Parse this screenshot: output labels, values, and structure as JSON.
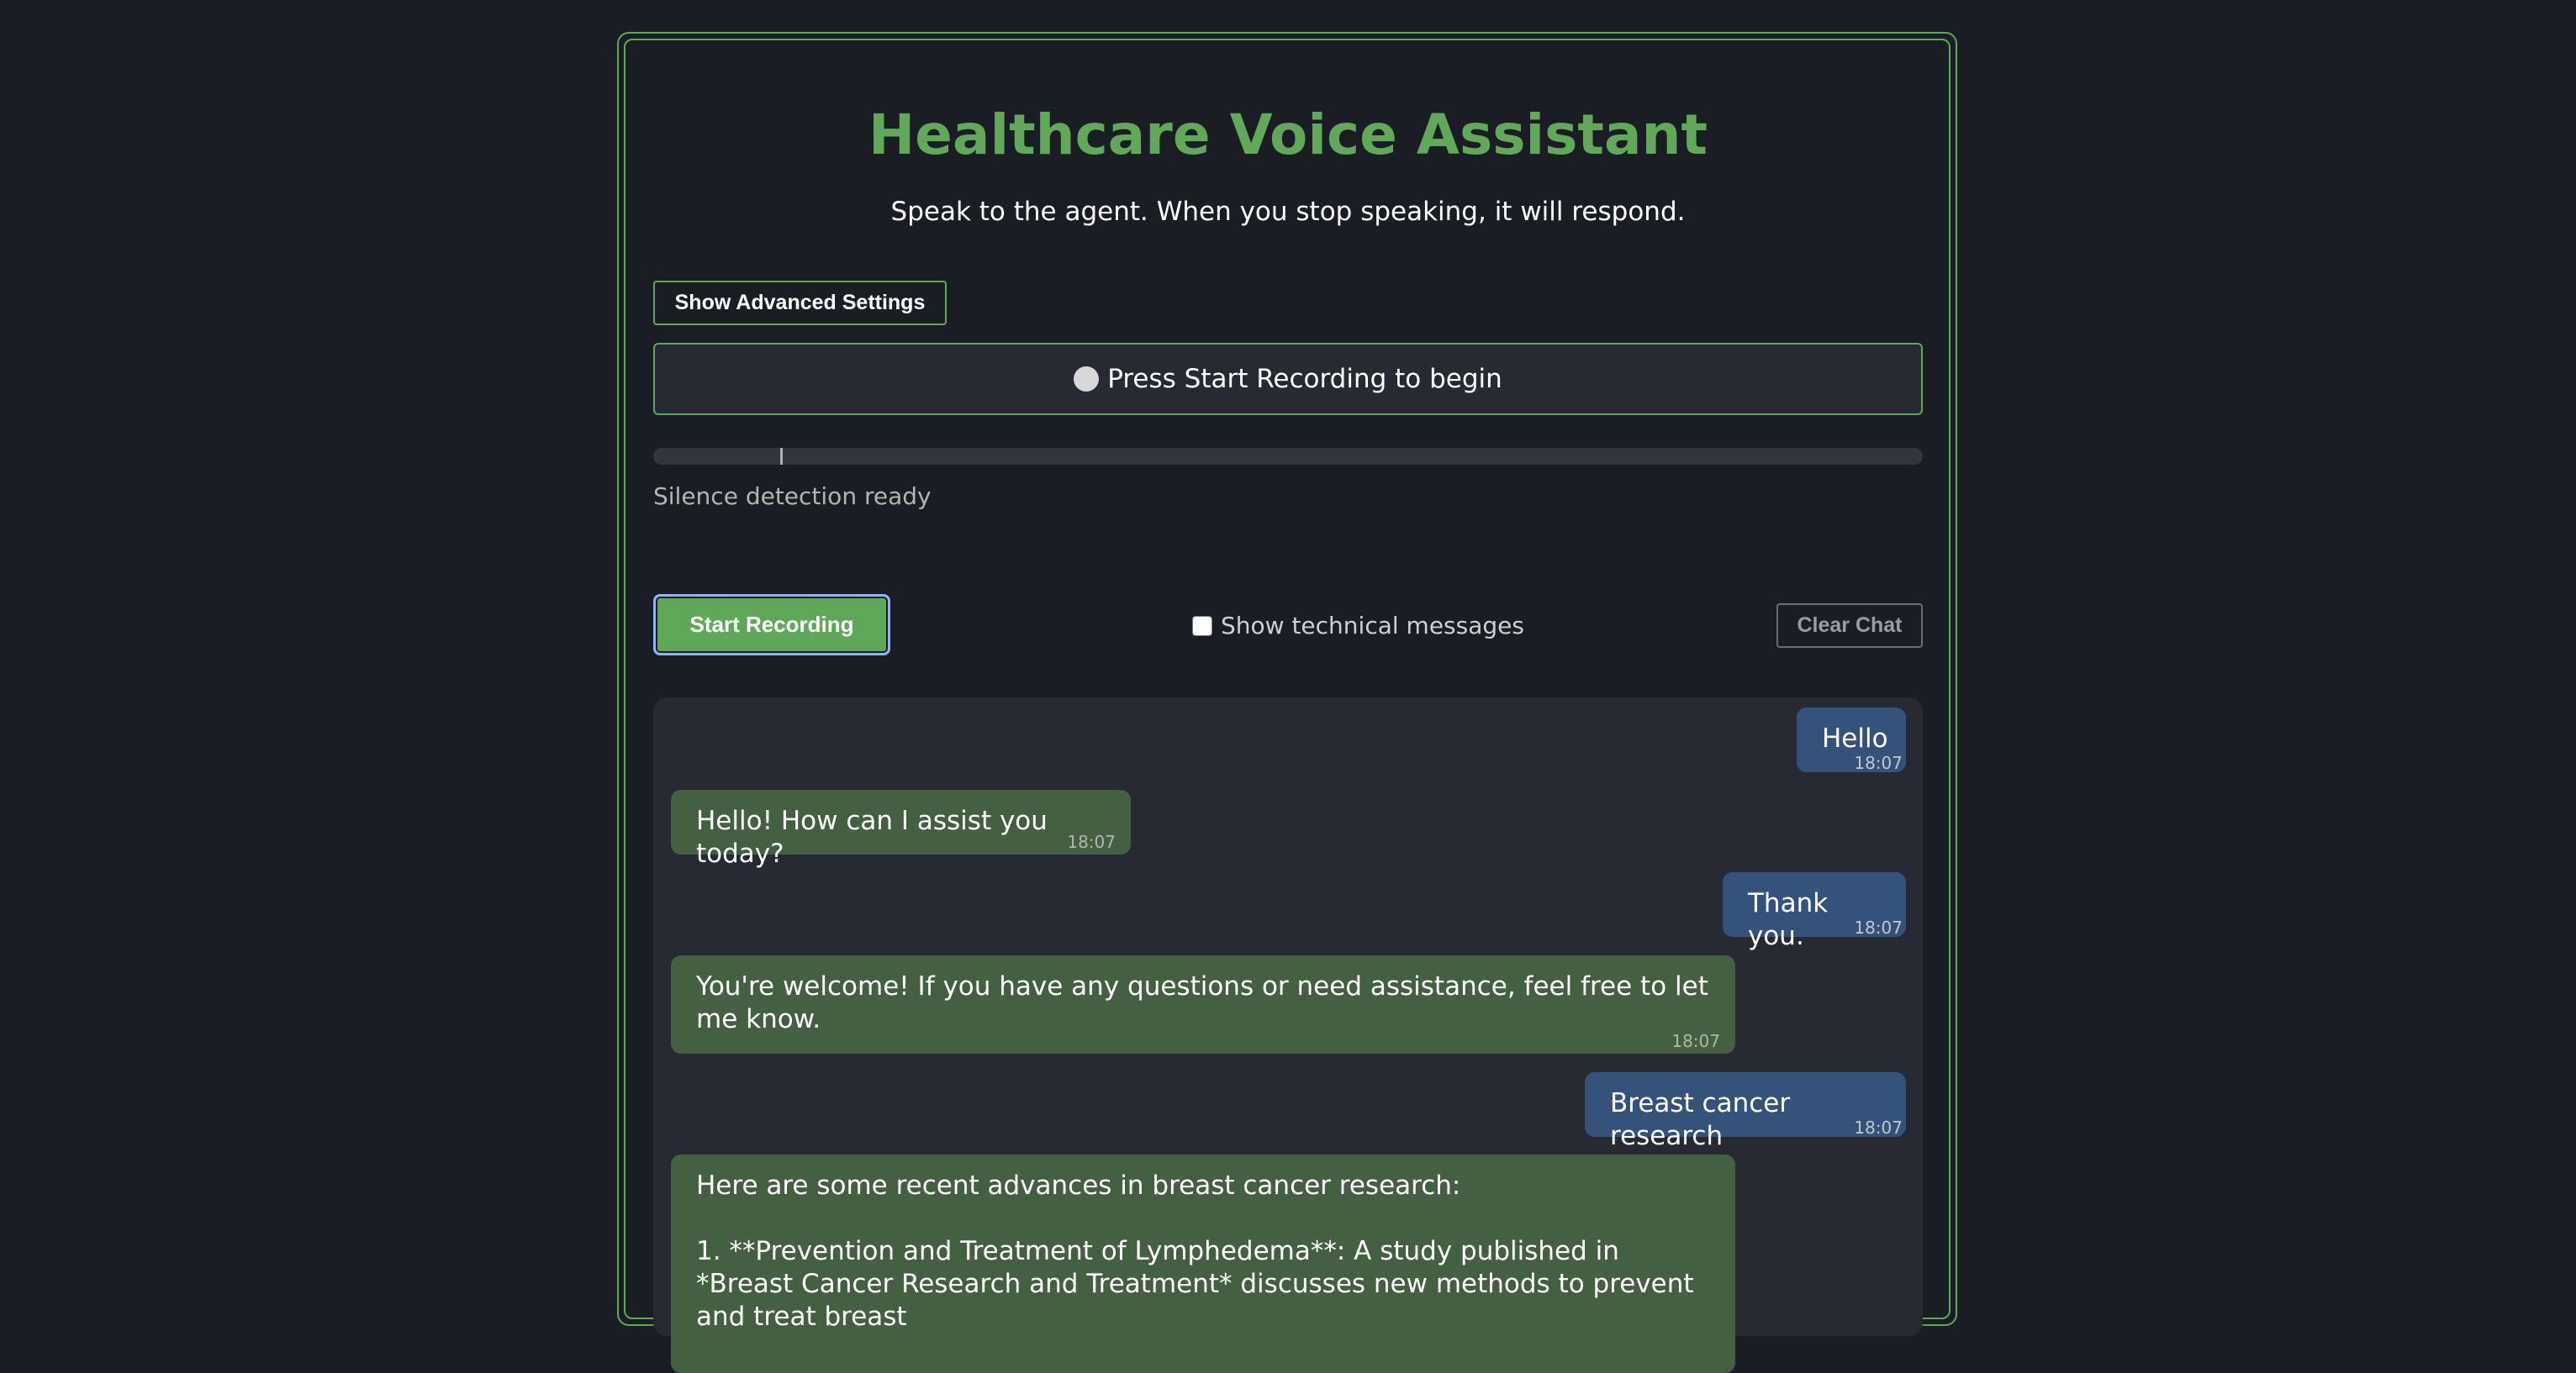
{
  "header": {
    "title": "Healthcare Voice Assistant",
    "subtitle": "Speak to the agent. When you stop speaking, it will respond."
  },
  "settings": {
    "advanced_label": "Show Advanced Settings"
  },
  "status": {
    "text": "Press Start Recording to begin",
    "silence_text": "Silence detection ready",
    "audio_level_fraction": 0.1
  },
  "controls": {
    "start_label": "Start Recording",
    "tech_messages_label": "Show technical messages",
    "tech_messages_checked": false,
    "clear_label": "Clear Chat"
  },
  "messages": [
    {
      "role": "user",
      "text": "Hello",
      "time": "18:07"
    },
    {
      "role": "bot",
      "text": "Hello! How can I assist you today?",
      "time": "18:07"
    },
    {
      "role": "user",
      "text": "Thank you.",
      "time": "18:07"
    },
    {
      "role": "bot",
      "text": "You're welcome! If you have any questions or need assistance, feel free to let me know.",
      "time": "18:07"
    },
    {
      "role": "user",
      "text": "Breast cancer research",
      "time": "18:07"
    },
    {
      "role": "bot",
      "text": "Here are some recent advances in breast cancer research:\n\n1. **Prevention and Treatment of Lymphedema**: A study published in *Breast Cancer Research and Treatment* discusses new methods to prevent and treat breast",
      "time": ""
    }
  ],
  "colors": {
    "accent": "#5fa85a",
    "background": "#1b1d24",
    "user_bubble": "#35527a",
    "bot_bubble": "#455f42"
  }
}
